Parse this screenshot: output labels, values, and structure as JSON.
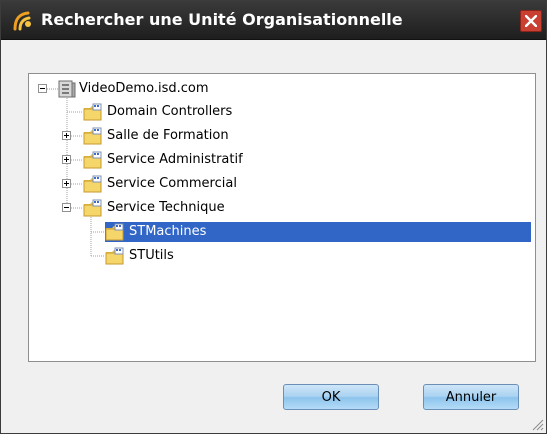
{
  "window": {
    "title": "Rechercher une Unité Organisationnelle",
    "title_color": "#ffffff",
    "titlebar_color": "#2b2b2b",
    "close_color": "#c94032"
  },
  "tree": {
    "root": {
      "label": "VideoDemo.isd.com",
      "icon": "server-icon",
      "expanded": true
    },
    "items": [
      {
        "label": "Domain Controllers",
        "icon": "folder-ou-icon",
        "expander": "none"
      },
      {
        "label": "Salle de Formation",
        "icon": "folder-ou-icon",
        "expander": "plus"
      },
      {
        "label": "Service Administratif",
        "icon": "folder-ou-icon",
        "expander": "plus"
      },
      {
        "label": "Service Commercial",
        "icon": "folder-ou-icon",
        "expander": "plus"
      },
      {
        "label": "Service Technique",
        "icon": "folder-ou-icon",
        "expander": "minus",
        "children": [
          {
            "label": "STMachines",
            "icon": "folder-ou-icon",
            "selected": true
          },
          {
            "label": "STUtils",
            "icon": "folder-ou-icon",
            "selected": false
          }
        ]
      }
    ],
    "selection_color": "#3165c6"
  },
  "buttons": {
    "ok_label": "OK",
    "cancel_label": "Annuler"
  }
}
